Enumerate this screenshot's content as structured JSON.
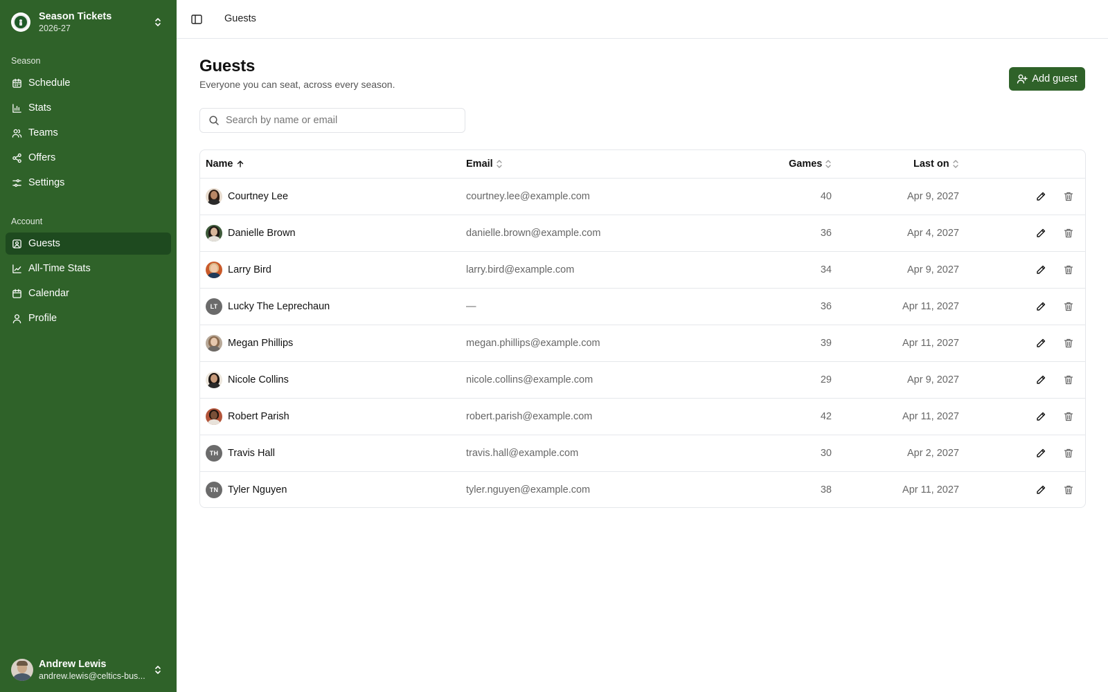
{
  "sidebar": {
    "team": {
      "name": "Season Tickets",
      "season": "2026-27"
    },
    "sections": [
      {
        "label": "Season"
      },
      {
        "label": "Account"
      }
    ],
    "season_items": [
      {
        "label": "Schedule",
        "icon": "calendar-grid-icon"
      },
      {
        "label": "Stats",
        "icon": "bar-chart-icon"
      },
      {
        "label": "Teams",
        "icon": "users-icon"
      },
      {
        "label": "Offers",
        "icon": "share-icon"
      },
      {
        "label": "Settings",
        "icon": "sliders-icon"
      }
    ],
    "account_items": [
      {
        "label": "Guests",
        "icon": "contact-icon",
        "active": true
      },
      {
        "label": "All-Time Stats",
        "icon": "line-chart-icon"
      },
      {
        "label": "Calendar",
        "icon": "calendar-icon"
      },
      {
        "label": "Profile",
        "icon": "user-icon"
      }
    ],
    "user": {
      "name": "Andrew Lewis",
      "email": "andrew.lewis@celtics-bus..."
    }
  },
  "topbar": {
    "breadcrumb": "Guests"
  },
  "page": {
    "title": "Guests",
    "subtitle": "Everyone you can seat, across every season.",
    "add_button": "Add guest"
  },
  "search": {
    "placeholder": "Search by name or email",
    "value": ""
  },
  "table": {
    "columns": {
      "name": "Name",
      "email": "Email",
      "games": "Games",
      "last_on": "Last on"
    },
    "sort": {
      "column": "name",
      "direction": "asc"
    },
    "rows": [
      {
        "name": "Courtney Lee",
        "email": "courtney.lee@example.com",
        "games": "40",
        "last_on": "Apr 9, 2027",
        "avatar": "photo",
        "initials": ""
      },
      {
        "name": "Danielle Brown",
        "email": "danielle.brown@example.com",
        "games": "36",
        "last_on": "Apr 4, 2027",
        "avatar": "photo",
        "initials": ""
      },
      {
        "name": "Larry Bird",
        "email": "larry.bird@example.com",
        "games": "34",
        "last_on": "Apr 9, 2027",
        "avatar": "photo",
        "initials": ""
      },
      {
        "name": "Lucky The Leprechaun",
        "email": "—",
        "games": "36",
        "last_on": "Apr 11, 2027",
        "avatar": "initials",
        "initials": "LT"
      },
      {
        "name": "Megan Phillips",
        "email": "megan.phillips@example.com",
        "games": "39",
        "last_on": "Apr 11, 2027",
        "avatar": "photo",
        "initials": ""
      },
      {
        "name": "Nicole Collins",
        "email": "nicole.collins@example.com",
        "games": "29",
        "last_on": "Apr 9, 2027",
        "avatar": "photo",
        "initials": ""
      },
      {
        "name": "Robert Parish",
        "email": "robert.parish@example.com",
        "games": "42",
        "last_on": "Apr 11, 2027",
        "avatar": "photo",
        "initials": ""
      },
      {
        "name": "Travis Hall",
        "email": "travis.hall@example.com",
        "games": "30",
        "last_on": "Apr 2, 2027",
        "avatar": "initials",
        "initials": "TH"
      },
      {
        "name": "Tyler Nguyen",
        "email": "tyler.nguyen@example.com",
        "games": "38",
        "last_on": "Apr 11, 2027",
        "avatar": "initials",
        "initials": "TN"
      }
    ]
  },
  "colors": {
    "brand": "#2f6229",
    "brand_active": "#1e4a1f",
    "border": "#e5e7eb",
    "muted_text": "#666666"
  }
}
